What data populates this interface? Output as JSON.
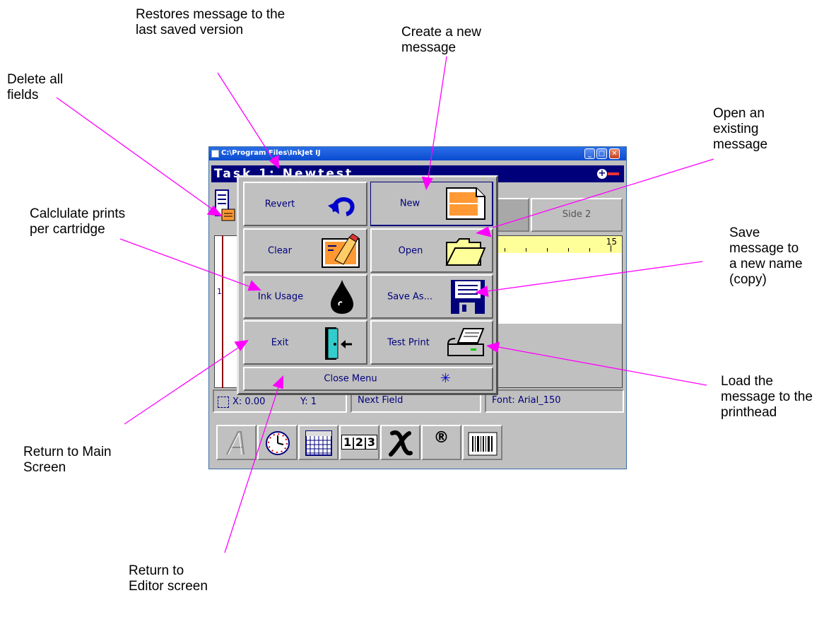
{
  "window": {
    "title": "C:\\Program Files\\InkJet  IJ",
    "min_glyph": "_",
    "max_glyph": "□",
    "close_glyph": "✕",
    "task_title": "Task 1: Newtest",
    "zoom_glyph": "+"
  },
  "side2_label": "Side 2",
  "ruler_number": "15",
  "row_number": "1",
  "status": {
    "x_label": "X: 0.00",
    "y_label": "Y: 1",
    "next_field": "Next Field",
    "font": "Font: Arial_150"
  },
  "toolbar": {
    "num_glyph": "1|2|3",
    "registered_glyph": "®"
  },
  "menu": {
    "revert": "Revert",
    "new": "New",
    "clear": "Clear",
    "open": "Open",
    "ink_usage": "Ink Usage",
    "save_as": "Save As...",
    "exit": "Exit",
    "test_print": "Test Print",
    "close_menu": "Close Menu",
    "close_glyph": "✳"
  },
  "callouts": {
    "restores": "Restores message to the last saved version",
    "create_new": "Create a new message",
    "delete_all": "Delete all fields",
    "open_existing": "Open an existing message",
    "calc_prints": "Calclulate prints per cartridge",
    "save_as": "Save message to a new name (copy)",
    "return_main": "Return to Main Screen",
    "load_message": "Load the message to the printhead",
    "return_editor": "Return to Editor screen"
  },
  "colors": {
    "title_bar": "#0a4bcf",
    "task_bar": "#00007b",
    "leader_lines": "#ff00ff",
    "ruler": "#ffff99",
    "button_face": "#c0c0c0"
  }
}
